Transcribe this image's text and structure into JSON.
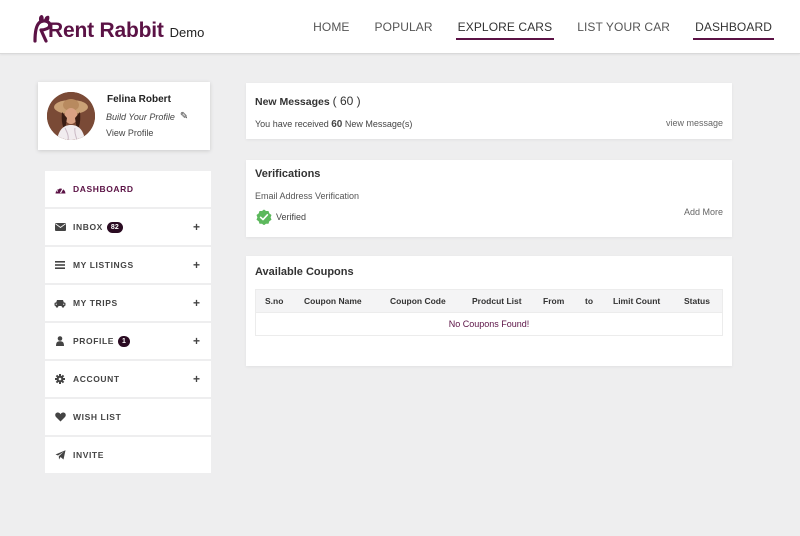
{
  "brand": {
    "name": "Rent Rabbit",
    "suffix": "Demo",
    "color": "#5b1245"
  },
  "nav": [
    {
      "label": "HOME",
      "active": false
    },
    {
      "label": "POPULAR",
      "active": false
    },
    {
      "label": "EXPLORE CARS",
      "active": true
    },
    {
      "label": "LIST YOUR CAR",
      "active": false
    },
    {
      "label": "DASHBOARD",
      "active": true
    }
  ],
  "profile": {
    "name": "Felina Robert",
    "build_label": "Build Your Profile",
    "view_label": "View Profile"
  },
  "menu": [
    {
      "label": "DASHBOARD",
      "icon": "dashboard-icon",
      "active": true,
      "badge": null,
      "expandable": false
    },
    {
      "label": "INBOX",
      "icon": "envelope-icon",
      "active": false,
      "badge": "82",
      "expandable": true
    },
    {
      "label": "MY LISTINGS",
      "icon": "list-icon",
      "active": false,
      "badge": null,
      "expandable": true
    },
    {
      "label": "MY TRIPS",
      "icon": "car-icon",
      "active": false,
      "badge": null,
      "expandable": true
    },
    {
      "label": "PROFILE",
      "icon": "user-icon",
      "active": false,
      "badge": "1",
      "expandable": true
    },
    {
      "label": "ACCOUNT",
      "icon": "gear-icon",
      "active": false,
      "badge": null,
      "expandable": true
    },
    {
      "label": "WISH LIST",
      "icon": "heart-icon",
      "active": false,
      "badge": null,
      "expandable": false
    },
    {
      "label": "INVITE",
      "icon": "paper-plane-icon",
      "active": false,
      "badge": null,
      "expandable": false
    }
  ],
  "messages": {
    "title": "New Messages",
    "count": "( 60 )",
    "line_prefix": "You have received",
    "line_count": "60",
    "line_suffix": "New Message(s)",
    "view_link": "view message"
  },
  "verifications": {
    "title": "Verifications",
    "subtitle": "Email Address Verification",
    "status": "Verified",
    "status_color": "#5cb85c",
    "add_more": "Add More"
  },
  "coupons": {
    "title": "Available Coupons",
    "columns": [
      "S.no",
      "Coupon Name",
      "Coupon Code",
      "Prodcut List",
      "From",
      "to",
      "Limit Count",
      "Status"
    ],
    "empty_message": "No Coupons Found!"
  }
}
